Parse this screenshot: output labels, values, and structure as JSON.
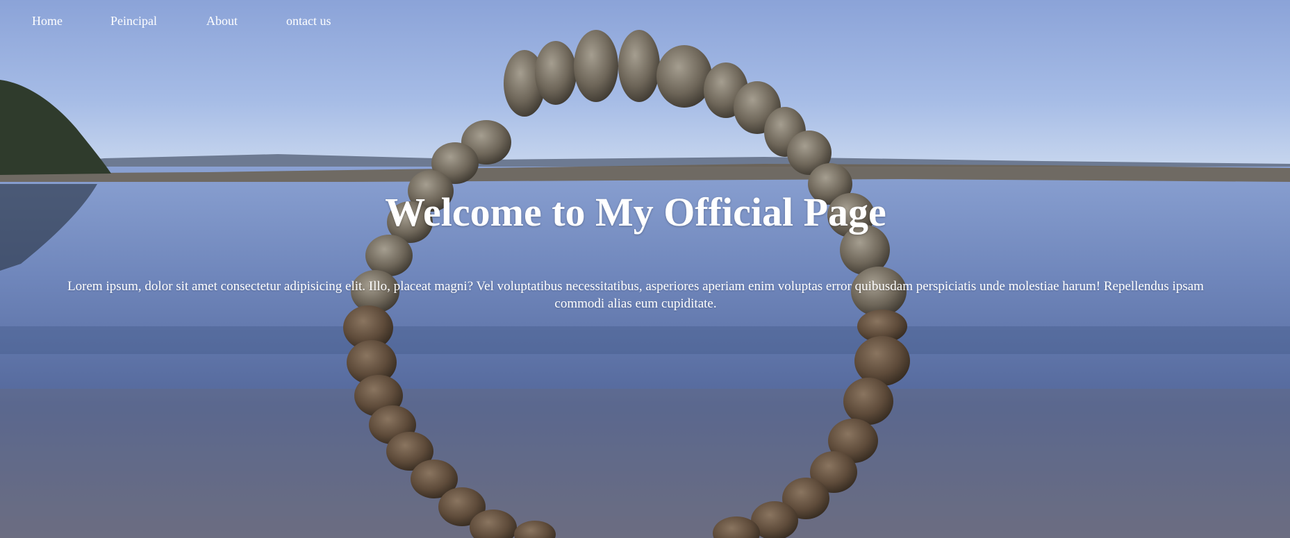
{
  "nav": {
    "items": [
      {
        "label": "Home"
      },
      {
        "label": "Peincipal"
      },
      {
        "label": "About"
      },
      {
        "label": "ontact us"
      }
    ]
  },
  "hero": {
    "title": "Welcome to My Official Page",
    "text": "Lorem ipsum, dolor sit amet consectetur adipisicing elit. Illo, placeat magni? Vel voluptatibus necessitatibus, asperiores aperiam enim voluptas error quibusdam perspiciatis unde molestiae harum! Repellendus ipsam commodi alias eum cupiditate.",
    "background_image": "stone-circle-in-lake-photo"
  },
  "colors": {
    "text": "#ffffff",
    "sky": "#8ea6d6",
    "water": "#5a6f9f"
  }
}
